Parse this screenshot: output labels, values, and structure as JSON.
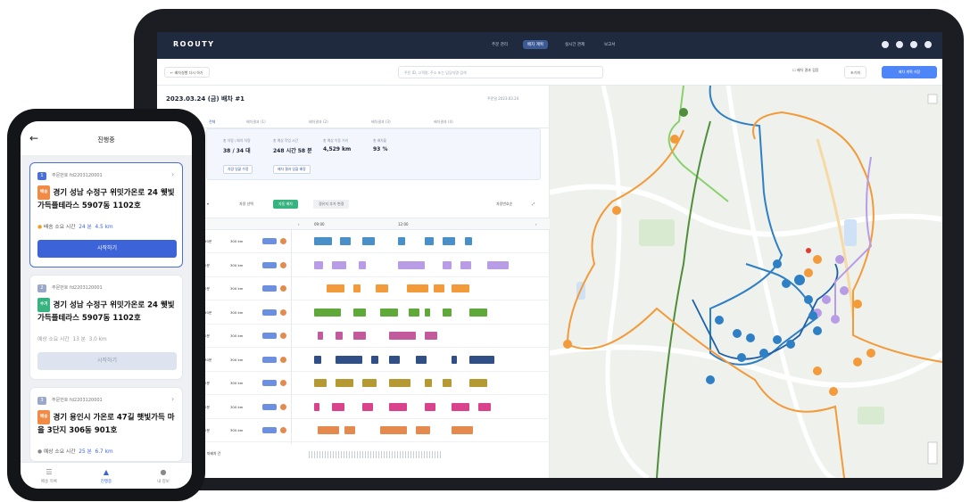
{
  "app": {
    "logo": "ROOUTY"
  },
  "nav": {
    "tabs": [
      "주문 관리",
      "배차 계획",
      "실시간 관제",
      "보고서"
    ],
    "active_index": 1
  },
  "toolbar": {
    "back_label": "← 배차실행 다시 하기",
    "search_placeholder": "주문 ID, 고객명, 주소 또는 담당자명 검색",
    "checkbox_label": "배차 결과 검증",
    "secondary_button": "초기화",
    "primary_button": "배차 계획 저장"
  },
  "dispatch": {
    "header": "2023.03.24 (금) 배차 #1",
    "right_date": "주문일 2023.03.24",
    "subtabs": [
      "전체",
      "배차결과 (1)",
      "배차결과 (2)",
      "배차결과 (3)",
      "배차결과 (4)"
    ]
  },
  "summary": [
    {
      "label": "총 차량 / 배차 차량",
      "value": "38 / 34 대"
    },
    {
      "label": "총 예상 작업 시간",
      "value": "248 시간 58 분"
    },
    {
      "label": "총 예상 이동 거리",
      "value": "4,529 km"
    },
    {
      "label": "총 배차율",
      "value": "93 %"
    }
  ],
  "summary_chips": [
    "차량 일괄 수정",
    "배차 결과 일괄 배정"
  ],
  "gantt": {
    "toggle": "차량 선택",
    "green_chip": "자동 배차",
    "gray_chip": "경유지 추가 변경",
    "time_labels": [
      "09:00",
      "12:00"
    ],
    "sort": "차량번호순",
    "rows": [
      {
        "vehicle": "차량 100건",
        "hours": "10시간 30분",
        "km": "300 km"
      },
      {
        "vehicle": "차량 90건",
        "hours": "9시간 30분",
        "km": "300 km"
      },
      {
        "vehicle": "차량 90건",
        "hours": "9시간 30분",
        "km": "300 km"
      },
      {
        "vehicle": "차량 86건",
        "hours": "10시간 30분",
        "km": "300 km"
      },
      {
        "vehicle": "차량 99건",
        "hours": "9시간 30분",
        "km": "300 km"
      },
      {
        "vehicle": "차량 100건",
        "hours": "10시간 30분",
        "km": "300 km"
      },
      {
        "vehicle": "차량 90건",
        "hours": "8시간 30분",
        "km": "300 km"
      },
      {
        "vehicle": "차량 99건",
        "hours": "9시간 30분",
        "km": "300 km"
      },
      {
        "vehicle": "차량 96건",
        "hours": "8시간 30분",
        "km": "300 km"
      }
    ],
    "bottom_label": "미배차 건"
  },
  "phone": {
    "title": "진행중",
    "cards": [
      {
        "num": "1",
        "order": "주문번호  fd2203120001",
        "tag": "배송",
        "tag_color": "#f08a45",
        "address": "경기 성남 수정구 위밋가온로 24 웻빛가득플테라스 5907동 1102호",
        "meta_prefix": "배송 소요 시간",
        "time": "24 분",
        "dist": "4.5 km",
        "button": "시작하기",
        "active": true,
        "num_color": "#4a6fd6"
      },
      {
        "num": "2",
        "order": "주문번호  fd2203120001",
        "tag": "수거",
        "tag_color": "#36b37e",
        "address": "경기 성남 수정구 위밋가온로 24 웻빛가득플테라스 5907동 1102호",
        "meta_prefix": "예상 소요 시간",
        "time": "13 분",
        "dist": "3.0 km",
        "button": "시작하기",
        "active": false,
        "num_color": "#9aa8c9"
      },
      {
        "num": "3",
        "order": "주문번호  fd2203120001",
        "tag": "배송",
        "tag_color": "#f08a45",
        "address": "경기 용인시 가온로 47길 햇빛가득 마을 3단지 306동 901호",
        "meta_prefix": "예상 소요 시간",
        "time": "25 분",
        "dist": "6.7 km",
        "button": "",
        "active": false,
        "num_color": "#9aa8c9"
      }
    ],
    "bottom_nav": [
      "배송 목록",
      "진행중",
      "내 정보"
    ]
  }
}
